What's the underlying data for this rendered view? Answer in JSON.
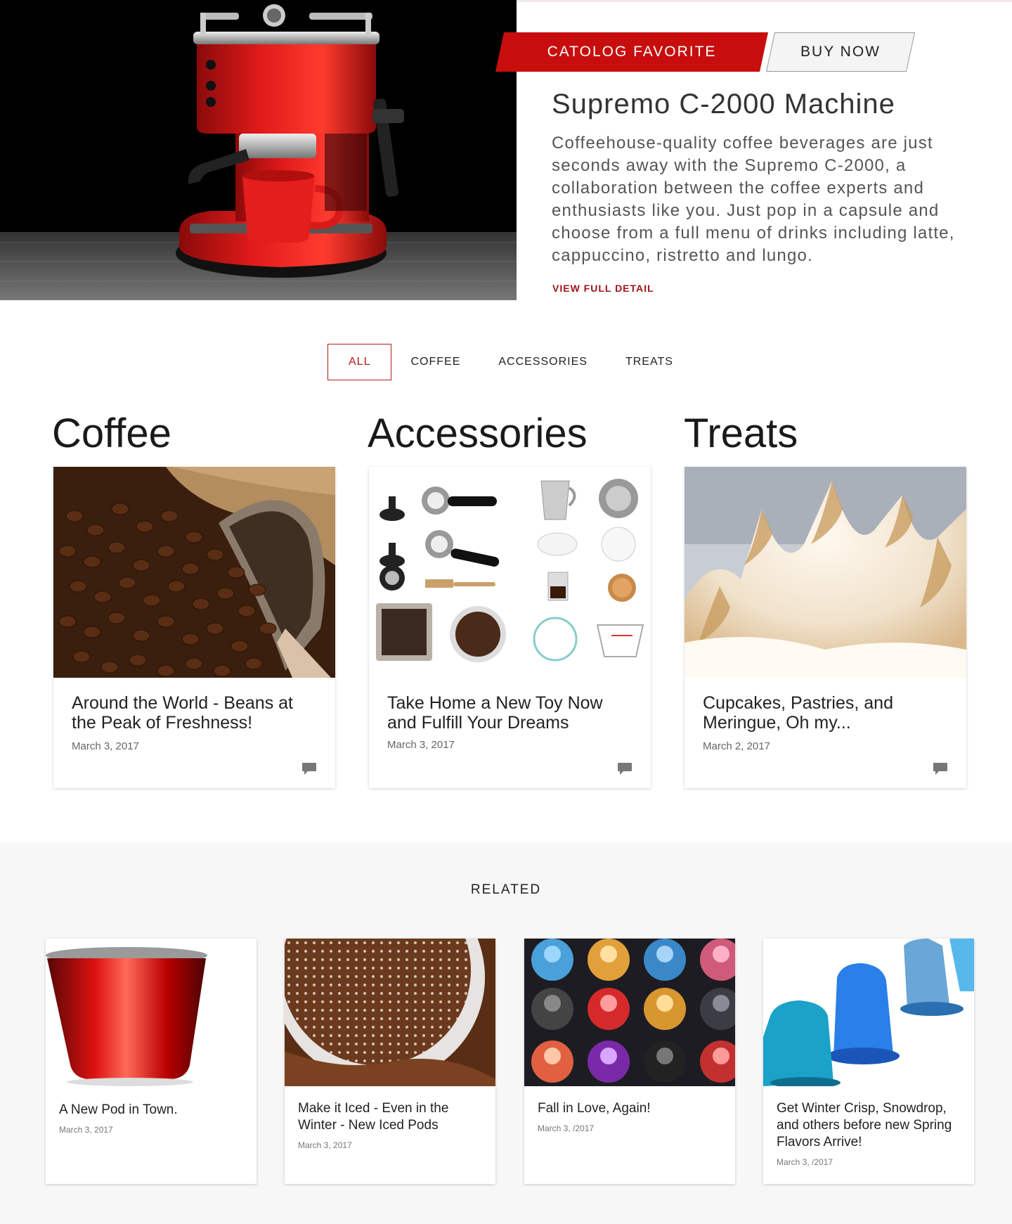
{
  "hero": {
    "badge": "CATOLOG FAVORITE",
    "buy_label": "BUY NOW",
    "title": "Supremo C-2000 Machine",
    "description": "Coffeehouse-quality coffee beverages are just seconds away with the Supremo C-2000, a collaboration between the coffee experts and enthusiasts like you. Just pop in a capsule and choose from a full menu of drinks including latte, cappuccino, ristretto and lungo.",
    "link": "VIEW FULL DETAIL"
  },
  "tabs": [
    "ALL",
    "COFFEE",
    "ACCESSORIES",
    "TREATS"
  ],
  "active_tab": "ALL",
  "categories": [
    {
      "heading": "Coffee",
      "card_title": "Around the World - Beans at the Peak of Freshness!",
      "date": "March 3, 2017"
    },
    {
      "heading": "Accessories",
      "card_title": "Take Home a New Toy Now and Fulfill Your Dreams",
      "date": "March 3, 2017"
    },
    {
      "heading": "Treats",
      "card_title": "Cupcakes, Pastries, and Meringue, Oh my...",
      "date": "March 2, 2017"
    }
  ],
  "related": {
    "title": "RELATED",
    "items": [
      {
        "title": "A New Pod in Town.",
        "date": "March 3, 2017"
      },
      {
        "title": "Make it Iced - Even in the Winter - New Iced Pods",
        "date": "March 3, 2017"
      },
      {
        "title": "Fall in Love, Again!",
        "date": "March 3, /2017"
      },
      {
        "title": "Get Winter Crisp, Snowdrop, and others before new Spring Flavors Arrive!",
        "date": "March 3, /2017"
      }
    ]
  },
  "colors": {
    "accent": "#c80d0d",
    "link": "#a0151b",
    "related_bg": "#f7f7f7"
  },
  "icons": {
    "comment": "comment-icon"
  }
}
